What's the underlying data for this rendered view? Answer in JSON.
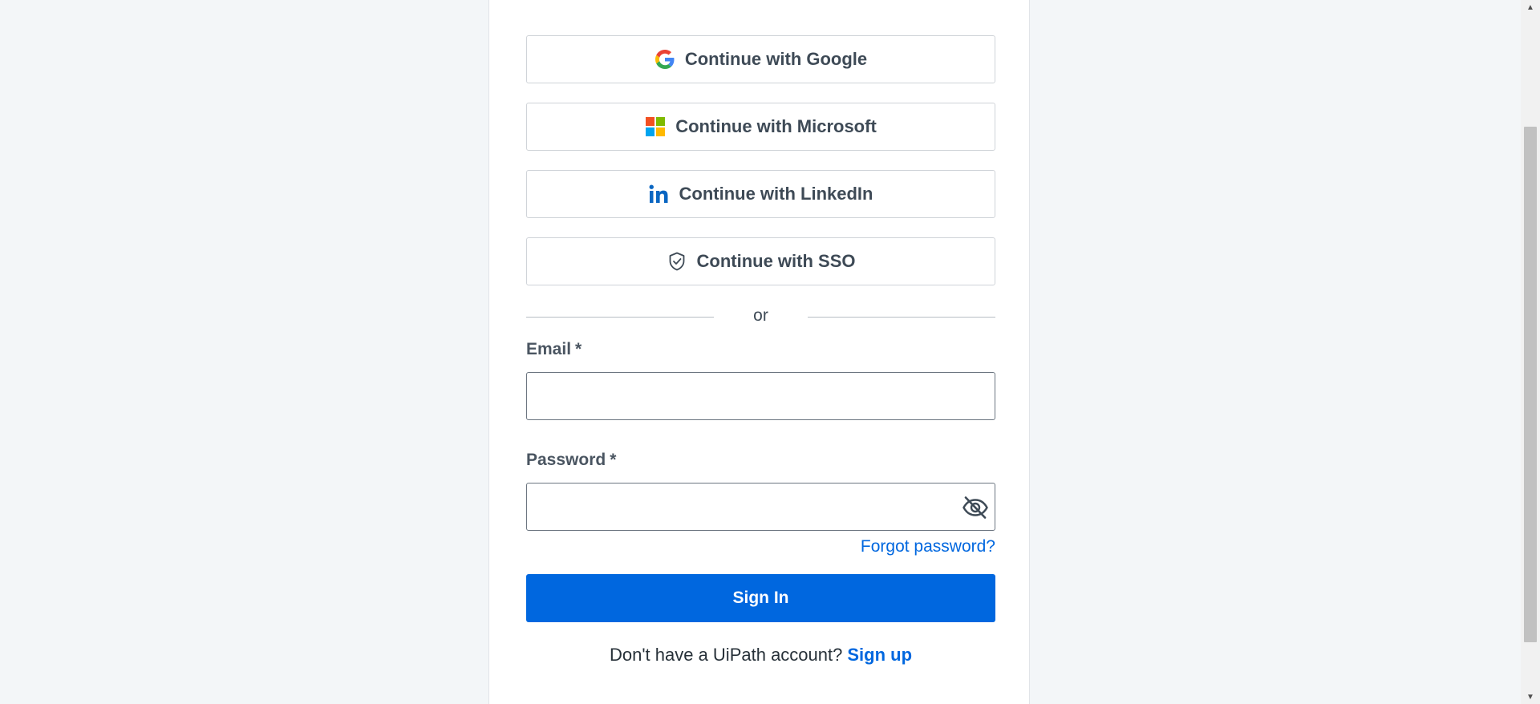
{
  "auth": {
    "google_label": "Continue with Google",
    "microsoft_label": "Continue with Microsoft",
    "linkedin_label": "Continue with LinkedIn",
    "sso_label": "Continue with SSO",
    "divider_text": "or",
    "email_label": "Email",
    "password_label": "Password",
    "required_marker": "*",
    "email_value": "",
    "password_value": "",
    "forgot_password": "Forgot password?",
    "sign_in": "Sign In",
    "no_account_text": "Don't have a UiPath account?",
    "sign_up": "Sign up"
  },
  "icons": {
    "google": "google-icon",
    "microsoft": "microsoft-icon",
    "linkedin": "linkedin-icon",
    "sso": "shield-check-icon",
    "password_toggle": "eye-off-icon"
  },
  "colors": {
    "primary": "#0067df",
    "background": "#f3f6f8",
    "text": "#3e4a56"
  }
}
